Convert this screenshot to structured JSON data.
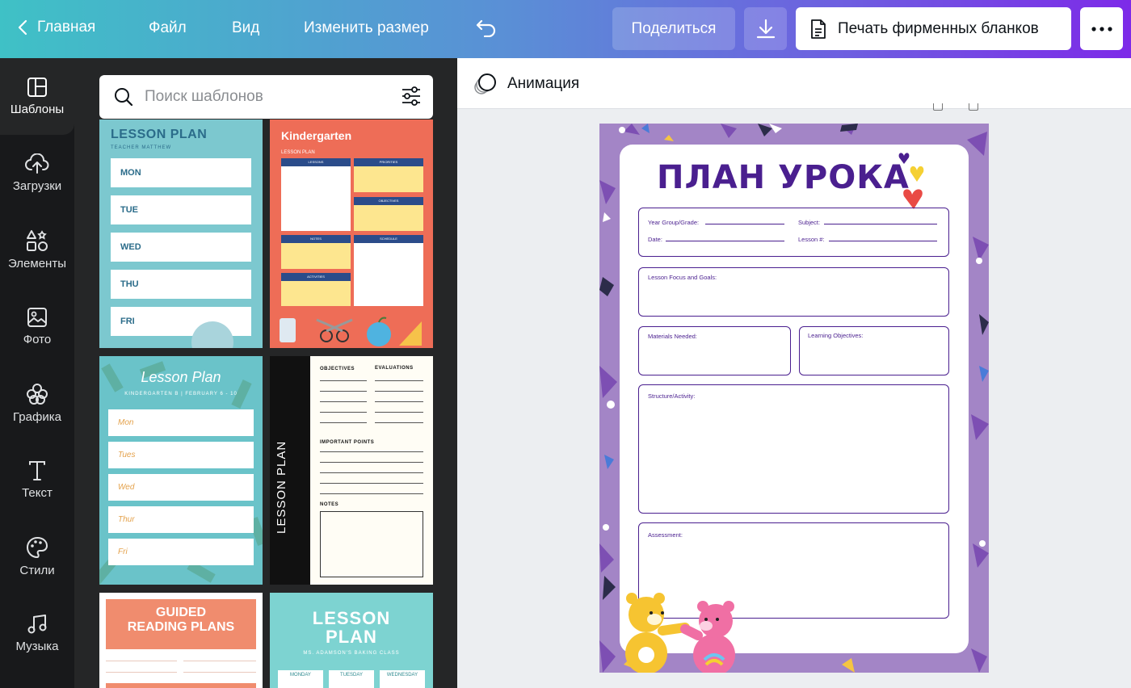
{
  "topbar": {
    "home": "Главная",
    "file": "Файл",
    "view": "Вид",
    "resize": "Изменить размер",
    "share": "Поделиться",
    "print": "Печать фирменных бланков"
  },
  "rail": {
    "items": [
      {
        "label": "Шаблоны",
        "icon": "templates-icon"
      },
      {
        "label": "Загрузки",
        "icon": "upload-icon"
      },
      {
        "label": "Элементы",
        "icon": "elements-icon"
      },
      {
        "label": "Фото",
        "icon": "photo-icon"
      },
      {
        "label": "Графика",
        "icon": "graphics-icon"
      },
      {
        "label": "Текст",
        "icon": "text-icon"
      },
      {
        "label": "Стили",
        "icon": "palette-icon"
      },
      {
        "label": "Музыка",
        "icon": "music-icon"
      }
    ]
  },
  "search": {
    "placeholder": "Поиск шаблонов"
  },
  "templates": {
    "t1": {
      "title": "LESSON PLAN",
      "sub": "TEACHER MATTHEW",
      "days": [
        "MON",
        "TUE",
        "WED",
        "THU",
        "FRI"
      ]
    },
    "t2": {
      "title": "Kindergarten",
      "sub": "LESSON PLAN",
      "heads": [
        "LESSONS",
        "PRIORITIES",
        "OBJECTIVES",
        "NOTES",
        "SCHEDULE",
        "ACTIVITIES"
      ]
    },
    "t3": {
      "title": "Lesson Plan",
      "sub": "KINDERGARTEN B | FEBRUARY 6 - 10",
      "days": [
        "Mon",
        "Tues",
        "Wed",
        "Thur",
        "Fri"
      ]
    },
    "t4": {
      "vertical": "LESSON PLAN",
      "objectives": "OBJECTIVES",
      "evaluations": "EVALUATIONS",
      "points": "IMPORTANT POINTS",
      "notes": "NOTES"
    },
    "t5": {
      "title_1": "GUIDED",
      "title_2": "READING PLANS"
    },
    "t6": {
      "title_1": "LESSON",
      "title_2": "PLAN",
      "sub": "MS. ADAMSON'S BAKING CLASS",
      "cols": [
        "MONDAY",
        "TUESDAY",
        "WEDNESDAY"
      ]
    }
  },
  "editor": {
    "animation": "Анимация"
  },
  "document": {
    "title": "ПЛАН УРОКА",
    "fields": {
      "year": "Year Group/Grade:",
      "subject": "Subject:",
      "date": "Date:",
      "lesson_no": "Lesson #:",
      "focus": "Lesson Focus and Goals:",
      "materials": "Materials Needed:",
      "objectives": "Learning Objectives:",
      "structure": "Structure/Activity:",
      "assessment": "Assessment:"
    }
  },
  "colors": {
    "brand_gradient_start": "#3fc1c6",
    "brand_gradient_end": "#7d2ae8",
    "doc_purple": "#4a1f8f",
    "doc_bg": "#a385c6"
  }
}
